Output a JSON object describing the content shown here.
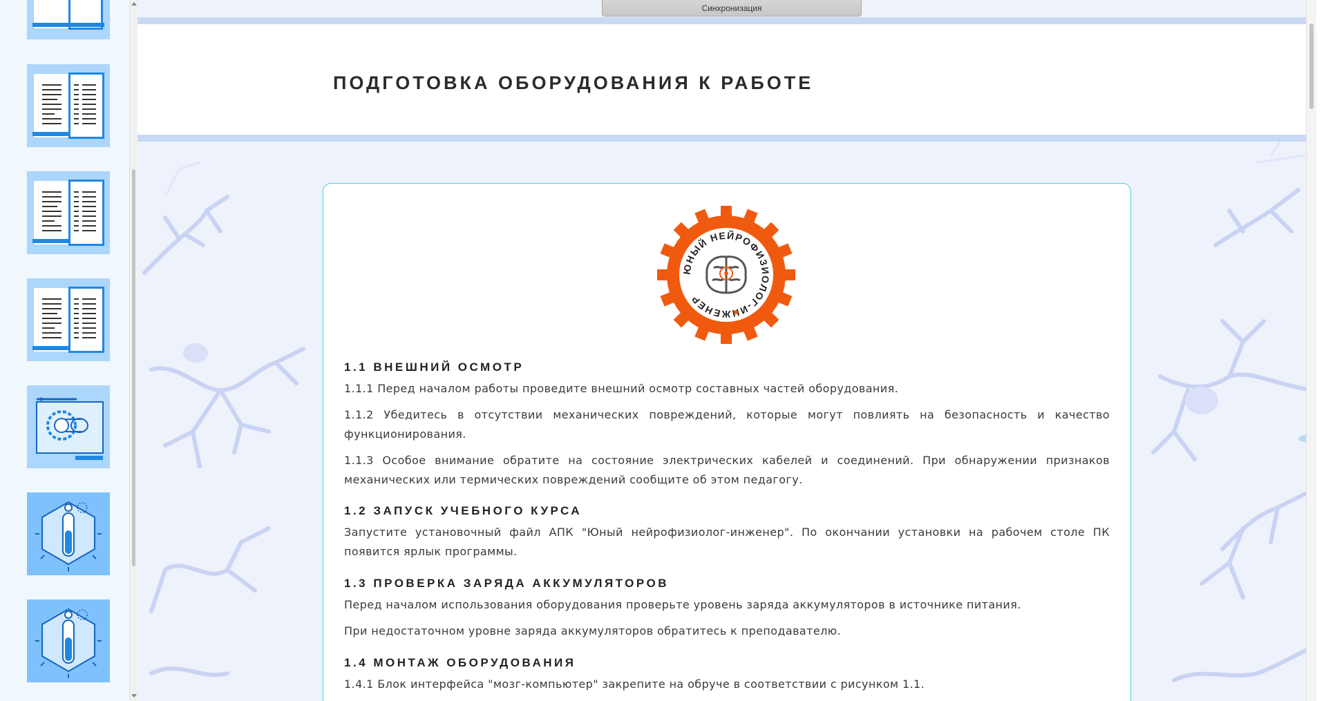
{
  "toolbar": {
    "sync_label": "Синхронизация"
  },
  "document": {
    "title": "ПОДГОТОВКА ОБОРУДОВАНИЯ К РАБОТЕ",
    "logo": {
      "ring_text": "ЮНЫЙ НЕЙРОФИЗИОЛОГ-ИНЖЕНЕР",
      "accent": "#f05a0e"
    },
    "sections": [
      {
        "heading": "1.1 ВНЕШНИЙ ОСМОТР",
        "paragraphs": [
          "1.1.1 Перед началом работы проведите внешний осмотр составных частей оборудования.",
          "1.1.2 Убедитесь в отсутствии механических повреждений, которые могут повлиять на безопасность и качество функционирования.",
          "1.1.3 Особое внимание обратите на состояние электрических кабелей и соединений. При обнаружении признаков механических или термических повреждений сообщите об этом педагогу."
        ]
      },
      {
        "heading": "1.2 ЗАПУСК УЧЕБНОГО КУРСА",
        "paragraphs": [
          "Запустите установочный файл АПК \"Юный нейрофизиолог-инженер\". По окончании установки на рабочем столе ПК появится ярлык программы."
        ]
      },
      {
        "heading": "1.3 ПРОВЕРКА ЗАРЯДА АККУМУЛЯТОРОВ",
        "paragraphs": [
          "Перед началом использования оборудования проверьте уровень заряда аккумуляторов в источнике питания.",
          "При недостаточном уровне заряда аккумуляторов обратитесь к преподавателю."
        ]
      },
      {
        "heading": "1.4 МОНТАЖ ОБОРУДОВАНИЯ",
        "paragraphs": [
          "1.4.1 Блок интерфейса \"мозг-компьютер\" закрепите на обруче в соответствии с рисунком 1.1."
        ]
      }
    ]
  },
  "sidebar": {
    "thumbnails": [
      {
        "icon": "book-icon"
      },
      {
        "icon": "book-icon"
      },
      {
        "icon": "book-icon"
      },
      {
        "icon": "book-icon"
      },
      {
        "icon": "blueprint-icon"
      },
      {
        "icon": "test-tube-icon"
      },
      {
        "icon": "test-tube-icon"
      }
    ]
  },
  "colors": {
    "accent_teal": "#4ed0d8",
    "band": "#c9d9f3",
    "sidebar_thumb": "#acd6fb",
    "orange": "#f05a0e"
  }
}
